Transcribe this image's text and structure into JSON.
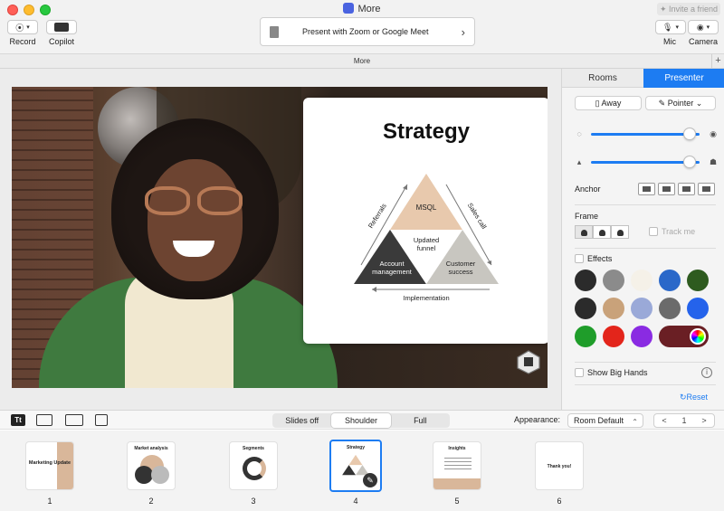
{
  "window": {
    "title": "More",
    "invite_label": "Invite a friend"
  },
  "toolbar": {
    "record_label": "Record",
    "copilot_label": "Copilot",
    "present_label": "Present with Zoom or Google Meet",
    "mic_label": "Mic",
    "camera_label": "Camera"
  },
  "tabbar": {
    "label": "More"
  },
  "slide": {
    "title": "Strategy",
    "top_label": "MSQL",
    "center_label_1": "Updated",
    "center_label_2": "funnel",
    "left_label_1": "Account",
    "left_label_2": "management",
    "right_label_1": "Customer",
    "right_label_2": "success",
    "left_arrow": "Referrals",
    "right_arrow": "Sales call",
    "bottom_arrow": "Implementation"
  },
  "panel": {
    "tabs": [
      "Rooms",
      "Presenter"
    ],
    "away_label": "Away",
    "pointer_label": "Pointer",
    "opacity_level": 0.95,
    "size_level": 0.95,
    "anchor_label": "Anchor",
    "frame_label": "Frame",
    "track_me_label": "Track me",
    "effects_label": "Effects",
    "big_hands_label": "Show Big Hands",
    "reset_label": "Reset",
    "swatch_colors": [
      "#2b2b2b",
      "#8b8b8b",
      "#f5f1e8",
      "#2a68c9",
      "#2e5b1f",
      "#2b2b2b",
      "#c9a27a",
      "#9aa9d8",
      "#6b6b6b",
      "#2563eb",
      "#1f9d2a",
      "#e3251b",
      "#8a2be2"
    ]
  },
  "bottombar": {
    "icon_text": "Tt",
    "modes": [
      "Slides off",
      "Shoulder",
      "Full"
    ],
    "active_mode": "Shoulder",
    "appearance_label": "Appearance:",
    "appearance_value": "Room Default",
    "page": "1",
    "prev": "<",
    "next": ">"
  },
  "filmstrip": {
    "slides": [
      {
        "number": "1",
        "title": "Marketing Update"
      },
      {
        "number": "2",
        "title": "Market analysis"
      },
      {
        "number": "3",
        "title": "Segments"
      },
      {
        "number": "4",
        "title": "Strategy"
      },
      {
        "number": "5",
        "title": "Insights"
      },
      {
        "number": "6",
        "title": "Thank you!"
      }
    ],
    "selected": "4"
  }
}
